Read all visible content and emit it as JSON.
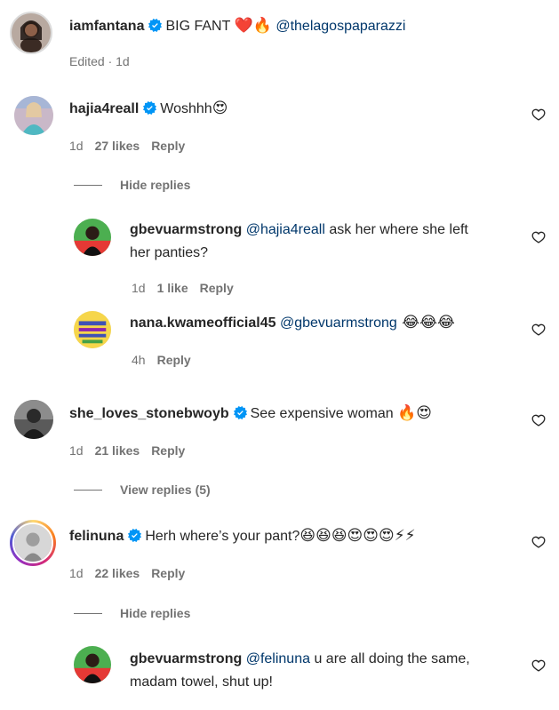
{
  "post": {
    "username": "iamfantana",
    "text": "BIG FANT ",
    "emojis": "❤️🔥",
    "mention": "@thelagospaparazzi",
    "meta": "Edited · 1d"
  },
  "comments": [
    {
      "username": "hajia4reall",
      "text": "Woshhh",
      "emojis": "😍",
      "time": "1d",
      "likes": "27 likes",
      "reply": "Reply",
      "toggle": "Hide replies"
    },
    {
      "username": "gbevuarmstrong",
      "mention": "@hajia4reall",
      "text_line1": " ask her where she left",
      "text_line2": "her panties?",
      "time": "1d",
      "likes": "1 like",
      "reply": "Reply"
    },
    {
      "username": "nana.kwameofficial45",
      "mention": "@gbevuarmstrong",
      "emojis": " 😂😂😂",
      "time": "4h",
      "reply": "Reply"
    },
    {
      "username": "she_loves_stonebwoyb",
      "text": "See expensive woman ",
      "emojis": "🔥😍",
      "time": "1d",
      "likes": "21 likes",
      "reply": "Reply",
      "toggle": "View replies (5)"
    },
    {
      "username": "felinuna",
      "text": "Herh where’s your pant?",
      "emojis": "😆😆😆😍😍😍⚡⚡",
      "time": "1d",
      "likes": "22 likes",
      "reply": "Reply",
      "toggle": "Hide replies"
    },
    {
      "username": "gbevuarmstrong",
      "mention": "@felinuna",
      "text_line1": " u are all doing the same,",
      "text_line2": "madam towel, shut up!"
    }
  ],
  "colors": {
    "text": "#262626",
    "secondary": "#737373",
    "mention": "#00376b",
    "verified": "#0095f6"
  }
}
